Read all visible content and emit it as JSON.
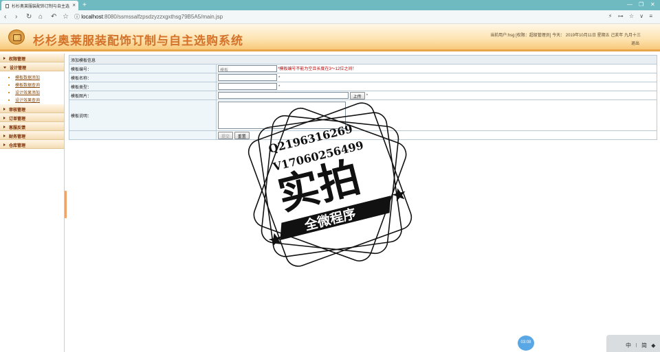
{
  "browser": {
    "tab_title": "杉杉奥莱服装配饰订制与自主选",
    "url_host": "localhost",
    "url_path": ":8080/ssmssalfzpsdzyzzxgxthsg79B5A5/main.jsp"
  },
  "app": {
    "title": "杉杉奥莱服装配饰订制与自主选购系统",
    "user_info": "当前用户:hsg [权限：超级管理员] 今天： 2019年10月11日 星期五 己亥年 九月十三",
    "logout": "退出"
  },
  "sidebar": {
    "menus": [
      {
        "label": "权限管理",
        "open": false
      },
      {
        "label": "设计管理",
        "open": true,
        "items": [
          "模板数据添加",
          "模板数据查询",
          "设计效果添加",
          "设计效果查询"
        ]
      },
      {
        "label": "审核管理",
        "open": false
      },
      {
        "label": "订单管理",
        "open": false
      },
      {
        "label": "客服反馈",
        "open": false
      },
      {
        "label": "财务管理",
        "open": false
      },
      {
        "label": "仓库管理",
        "open": false
      }
    ]
  },
  "form": {
    "caption": "添加模板信息",
    "fields": {
      "number_label": "模板编号：",
      "number_value": "模板",
      "number_hint": "*模板编号不能为空且长度在3～12位之间！",
      "name_label": "模板名称：",
      "type_label": "模板类型：",
      "image_label": "模板图片：",
      "upload_label": "上传",
      "desc_label": "模板说明：",
      "required": "*"
    },
    "submit_label": "提交",
    "reset_label": "重置"
  },
  "watermark": {
    "line1": "Q2196316269",
    "line2": "V17060256499",
    "big": "实拍",
    "banner": "全微程序"
  },
  "widgets": {
    "timer": "03:08",
    "ime": "中 ⁝ 简 ◆"
  }
}
